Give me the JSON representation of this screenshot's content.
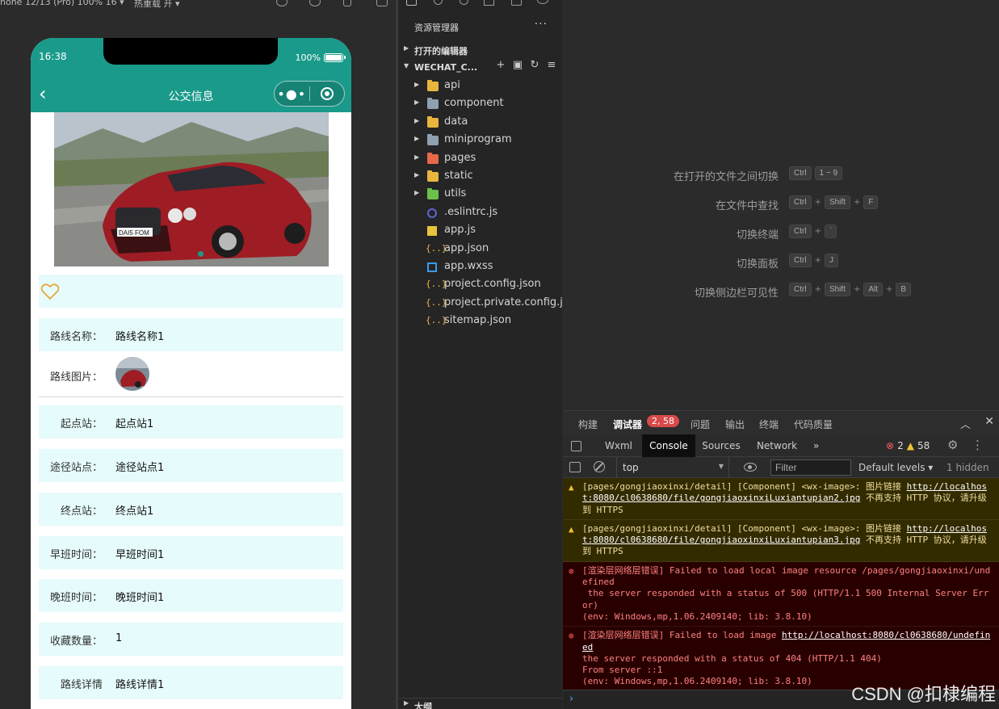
{
  "toolbar": {
    "device": "hone 12/13 (Pro) 100% 16 ▾",
    "network": "热重载 开 ▾"
  },
  "phone": {
    "time": "16:38",
    "battery": "100%",
    "title": "公交信息",
    "rows": [
      {
        "label": "路线名称：",
        "value": "路线名称1"
      },
      {
        "label": "路线图片：",
        "value": ""
      },
      {
        "label": "起点站：",
        "value": "起点站1"
      },
      {
        "label": "途径站点：",
        "value": "途径站点1"
      },
      {
        "label": "终点站：",
        "value": "终点站1"
      },
      {
        "label": "早班时间：",
        "value": "早班时间1"
      },
      {
        "label": "晚班时间：",
        "value": "晚班时间1"
      },
      {
        "label": "收藏数量：",
        "value": "1"
      },
      {
        "label": "路线详情",
        "value": "路线详情1"
      }
    ]
  },
  "explorer": {
    "title": "资源管理器",
    "open_editors": "打开的编辑器",
    "workspace": "WECHAT_C...",
    "outline": "大纲",
    "items": [
      {
        "label": "api",
        "kind": "folder",
        "color": "#e8b63c"
      },
      {
        "label": "component",
        "kind": "folder",
        "color": "#8fa0b0"
      },
      {
        "label": "data",
        "kind": "folder",
        "color": "#e8b63c"
      },
      {
        "label": "miniprogram",
        "kind": "folder",
        "color": "#8fa0b0"
      },
      {
        "label": "pages",
        "kind": "folder",
        "color": "#e8694a"
      },
      {
        "label": "static",
        "kind": "folder",
        "color": "#e8b63c"
      },
      {
        "label": "utils",
        "kind": "folder",
        "color": "#6cbf4a"
      },
      {
        "label": ".eslintrc.js",
        "kind": "eslint",
        "color": "#5a67d8"
      },
      {
        "label": "app.js",
        "kind": "js",
        "color": "#e8c33c"
      },
      {
        "label": "app.json",
        "kind": "json",
        "color": "#e8b63c"
      },
      {
        "label": "app.wxss",
        "kind": "wxss",
        "color": "#3c9be8"
      },
      {
        "label": "project.config.json",
        "kind": "json",
        "color": "#e8b63c"
      },
      {
        "label": "project.private.config.js...",
        "kind": "json",
        "color": "#e8b63c"
      },
      {
        "label": "sitemap.json",
        "kind": "json",
        "color": "#e8b63c"
      }
    ]
  },
  "welcome": {
    "shortcuts": [
      {
        "label": "在打开的文件之间切换",
        "keys": [
          "Ctrl",
          "1 ~ 9"
        ],
        "joined": false
      },
      {
        "label": "在文件中查找",
        "keys": [
          "Ctrl",
          "Shift",
          "F"
        ],
        "joined": true
      },
      {
        "label": "切换终端",
        "keys": [
          "Ctrl",
          "`"
        ],
        "joined": true
      },
      {
        "label": "切换面板",
        "keys": [
          "Ctrl",
          "J"
        ],
        "joined": true
      },
      {
        "label": "切换侧边栏可见性",
        "keys": [
          "Ctrl",
          "Shift",
          "Alt",
          "B"
        ],
        "joined": true
      }
    ]
  },
  "debugger": {
    "tabs": [
      "构建",
      "调试器",
      "问题",
      "输出",
      "终端",
      "代码质量"
    ],
    "badge": "2, 58",
    "devtools_tabs": [
      "Wxml",
      "Console",
      "Sources",
      "Network"
    ],
    "error_count": "2",
    "warn_count": "58",
    "context": "top",
    "filter_placeholder": "Filter",
    "levels": "Default levels ▾",
    "hidden": "1 hidden",
    "messages": [
      {
        "level": "warn",
        "pre": "[pages/gongjiaoxinxi/detail] [Component] <wx-image>: 图片链接 ",
        "link": "http://localhost:8080/cl0638680/file/gongjiaoxinxiLuxiantupian2.jpg",
        "post": " 不再支持 HTTP 协议，请升级到 HTTPS"
      },
      {
        "level": "warn",
        "pre": "[pages/gongjiaoxinxi/detail] [Component] <wx-image>: 图片链接 ",
        "link": "http://localhost:8080/cl0638680/file/gongjiaoxinxiLuxiantupian3.jpg",
        "post": " 不再支持 HTTP 协议，请升级到 HTTPS"
      },
      {
        "level": "err",
        "pre": "[渲染层网络层错误] Failed to load local image resource /pages/gongjiaoxinxi/undefined\n the server responded with a status of 500 (HTTP/1.1 500 Internal Server Error)\n(env: Windows,mp,1.06.2409140; lib: 3.8.10)",
        "link": "",
        "post": ""
      },
      {
        "level": "err",
        "pre": "[渲染层网络层错误] Failed to load image ",
        "link": "http://localhost:8080/cl0638680/undefined",
        "post": "\nthe server responded with a status of 404 (HTTP/1.1 404)\nFrom server ::1\n(env: Windows,mp,1.06.2409140; lib: 3.8.10)"
      }
    ]
  },
  "watermark": "CSDN @扣棣编程"
}
